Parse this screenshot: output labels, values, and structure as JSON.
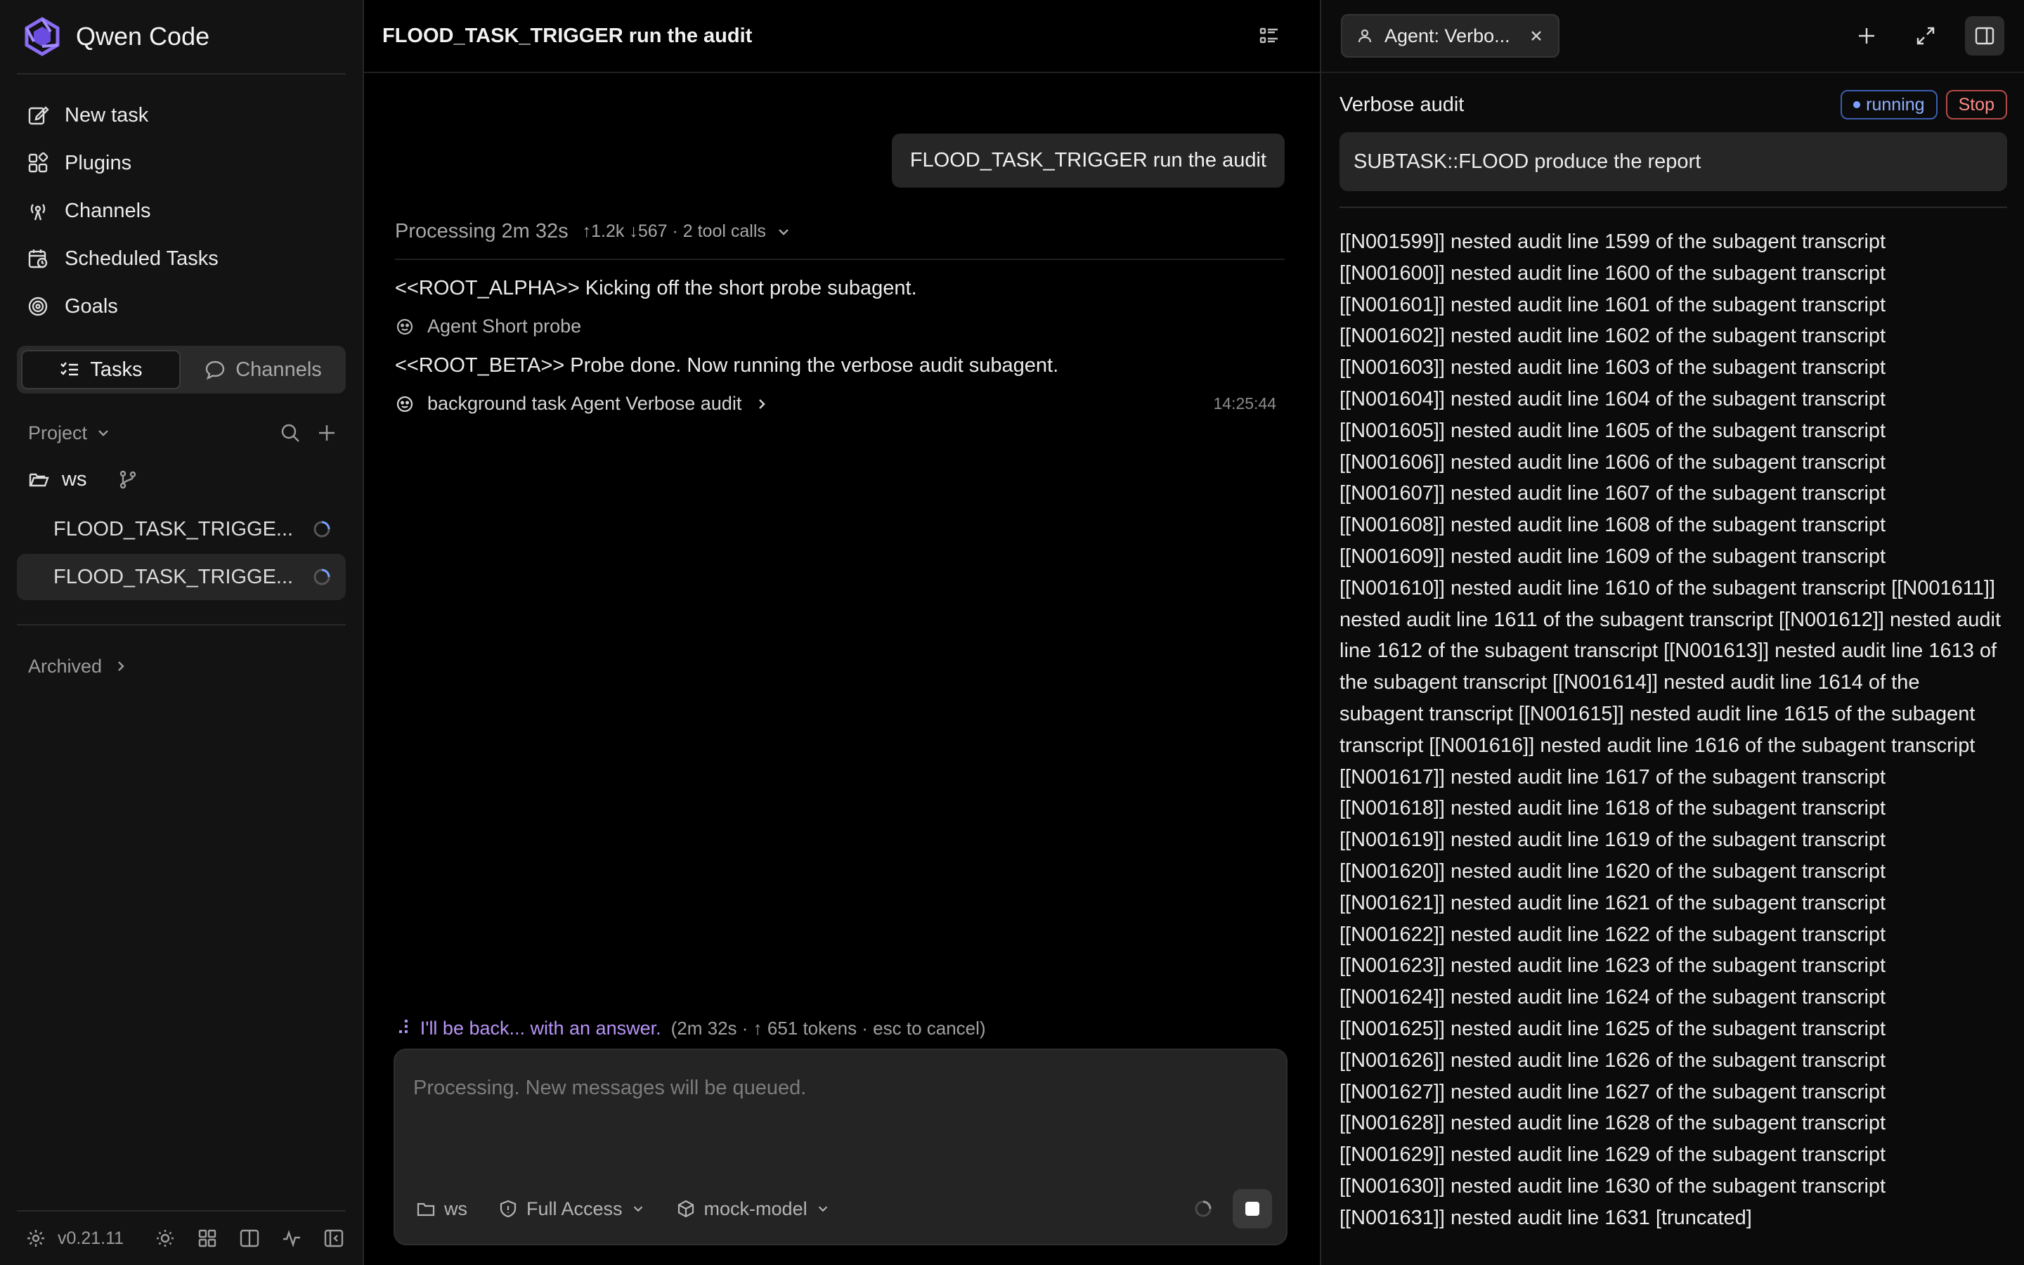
{
  "app": {
    "name": "Qwen Code",
    "version": "v0.21.11"
  },
  "sidebar": {
    "nav": [
      {
        "label": "New task",
        "icon": "edit-icon"
      },
      {
        "label": "Plugins",
        "icon": "plugin-icon"
      },
      {
        "label": "Channels",
        "icon": "broadcast-icon"
      },
      {
        "label": "Scheduled Tasks",
        "icon": "calendar-clock-icon"
      },
      {
        "label": "Goals",
        "icon": "target-icon"
      }
    ],
    "segments": {
      "tasks": "Tasks",
      "channels": "Channels"
    },
    "project_label": "Project",
    "folder": "ws",
    "tasks": [
      {
        "label": "FLOOD_TASK_TRIGGE..."
      },
      {
        "label": "FLOOD_TASK_TRIGGE..."
      }
    ],
    "archived_label": "Archived"
  },
  "main": {
    "title": "FLOOD_TASK_TRIGGER run the audit",
    "user_message": "FLOOD_TASK_TRIGGER run the audit",
    "processing": {
      "label": "Processing 2m 32s",
      "stats": "↑1.2k ↓567 · 2 tool calls"
    },
    "messages": {
      "alpha": "<<ROOT_ALPHA>> Kicking off the short probe subagent.",
      "agent_short": "Agent Short probe",
      "beta": "<<ROOT_BETA>> Probe done. Now running the verbose audit subagent.",
      "background": "background task Agent Verbose audit",
      "timestamp": "14:25:44"
    },
    "thinking": {
      "text": "I'll be back... with an answer.",
      "meta": "(2m 32s · ↑ 651 tokens · esc to cancel)"
    },
    "composer": {
      "placeholder": "Processing. New messages will be queued.",
      "folder": "ws",
      "access": "Full Access",
      "model": "mock-model"
    }
  },
  "panel": {
    "tab_label": "Agent: Verbo...",
    "title": "Verbose audit",
    "status": "running",
    "stop_label": "Stop",
    "prompt": "SUBTASK::FLOOD produce the report",
    "lines_before": [
      "[[N001599]] nested audit line 1599 of the subagent transcript",
      "[[N001600]] nested audit line 1600 of the subagent transcript",
      "[[N001601]] nested audit line 1601 of the subagent transcript",
      "[[N001602]] nested audit line 1602 of the subagent transcript",
      "[[N001603]] nested audit line 1603 of the subagent transcript",
      "[[N001604]] nested audit line 1604 of the subagent transcript",
      "[[N001605]] nested audit line 1605 of the subagent transcript",
      "[[N001606]] nested audit line 1606 of the subagent transcript",
      "[[N001607]] nested audit line 1607 of the subagent transcript",
      "[[N001608]] nested audit line 1608 of the subagent transcript",
      "[[N001609]] nested audit line 1609 of the subagent transcript"
    ],
    "wrapped_block": "[[N001610]] nested audit line 1610 of the subagent transcript [[N001611]] nested audit line 1611 of the subagent transcript [[N001612]] nested audit line 1612 of the subagent transcript [[N001613]] nested audit line 1613 of the subagent transcript [[N001614]] nested audit line 1614 of the subagent transcript [[N001615]] nested audit line 1615 of the subagent transcript [[N001616]] nested audit line 1616 of the subagent transcript",
    "lines_after": [
      "[[N001617]] nested audit line 1617 of the subagent transcript",
      "[[N001618]] nested audit line 1618 of the subagent transcript",
      "[[N001619]] nested audit line 1619 of the subagent transcript",
      "[[N001620]] nested audit line 1620 of the subagent transcript",
      "[[N001621]] nested audit line 1621 of the subagent transcript",
      "[[N001622]] nested audit line 1622 of the subagent transcript",
      "[[N001623]] nested audit line 1623 of the subagent transcript",
      "[[N001624]] nested audit line 1624 of the subagent transcript",
      "[[N001625]] nested audit line 1625 of the subagent transcript",
      "[[N001626]] nested audit line 1626 of the subagent transcript",
      "[[N001627]] nested audit line 1627 of the subagent transcript",
      "[[N001628]] nested audit line 1628 of the subagent transcript",
      "[[N001629]] nested audit line 1629 of the subagent transcript",
      "[[N001630]] nested audit line 1630 of the subagent transcript",
      "[[N001631]] nested audit line 1631 [truncated]"
    ]
  },
  "colors": {
    "accent": "#b894f7",
    "running": "#8fb0ff",
    "stop": "#ff8a8a",
    "logo": "#7c5cf2"
  }
}
